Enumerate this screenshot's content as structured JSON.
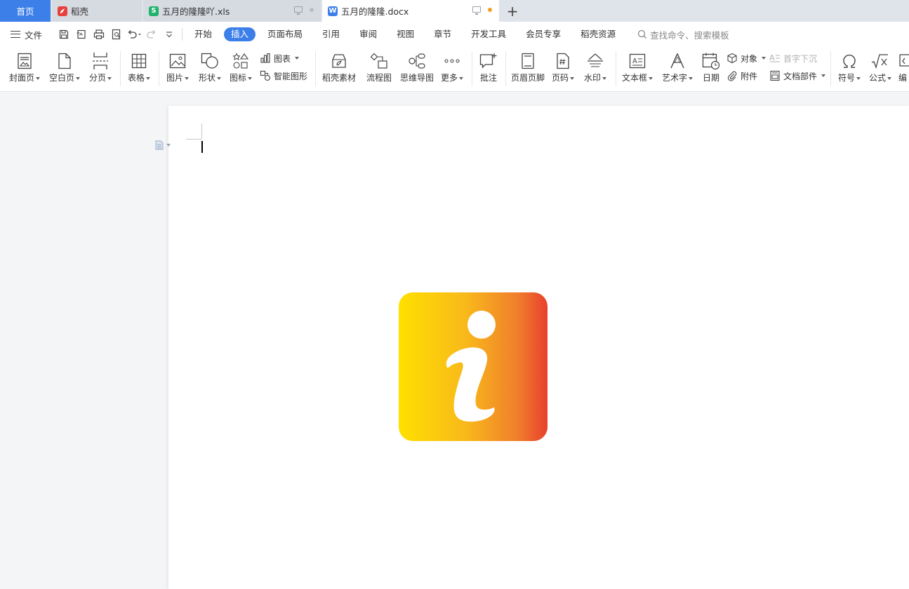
{
  "tabs": {
    "home": "首页",
    "items": [
      {
        "label": "稻壳",
        "icon": "daoke-icon",
        "color": "#e8413c"
      },
      {
        "label": "五月的隆隆吖.xls",
        "icon": "spreadsheet-icon",
        "color": "#1fb36b",
        "glyph": "S"
      },
      {
        "label": "五月的隆隆.docx",
        "icon": "writer-doc-icon",
        "color": "#3d7fe8",
        "glyph": "W"
      }
    ],
    "add": "+"
  },
  "menubar": {
    "file": "文件",
    "tabs": [
      "开始",
      "插入",
      "页面布局",
      "引用",
      "审阅",
      "视图",
      "章节",
      "开发工具",
      "会员专享",
      "稻壳资源"
    ],
    "active_tab": "插入",
    "search_placeholder": "查找命令、搜索模板"
  },
  "ribbon": {
    "cover": "封面页",
    "blank": "空白页",
    "pagebreak": "分页",
    "table": "表格",
    "picture": "图片",
    "shape": "形状",
    "icons": "图标",
    "chart": "图表",
    "smartart": "智能图形",
    "daoke_material": "稻壳素材",
    "flowchart": "流程图",
    "mindmap": "思维导图",
    "more": "更多",
    "comment": "批注",
    "header_footer": "页眉页脚",
    "page_number": "页码",
    "watermark": "水印",
    "textbox": "文本框",
    "wordart": "艺术字",
    "date": "日期",
    "object": "对象",
    "attachment": "附件",
    "drop_cap": "首字下沉",
    "doc_parts": "文档部件",
    "symbol": "符号",
    "formula": "公式",
    "edit_partial": "编"
  },
  "colors": {
    "accent": "#3d7fe8",
    "info_gradient_start": "#ffe000",
    "info_gradient_mid": "#f7a71e",
    "info_gradient_end": "#e8402c"
  }
}
